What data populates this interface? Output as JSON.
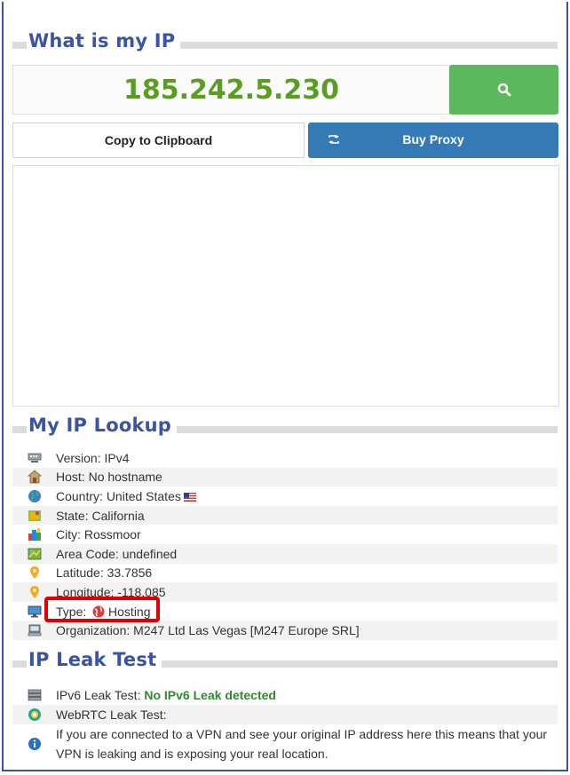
{
  "colors": {
    "brand": "#3a53a4",
    "ip_green": "#5a9e1f",
    "search_button": "#5cb85c",
    "buy_button": "#337ab7",
    "highlight": "#e00000",
    "leak_ok": "#2e8b2e"
  },
  "header": {
    "title": "What is my IP"
  },
  "ip": {
    "address": "185.242.5.230"
  },
  "actions": {
    "search_icon": "search-icon",
    "copy_label": "Copy to Clipboard",
    "buy_label": "Buy Proxy",
    "buy_icon": "retweet-icon"
  },
  "lookup": {
    "title": "My IP Lookup",
    "rows": [
      {
        "label": "Version:",
        "value": "IPv4",
        "icon": "network-card-icon"
      },
      {
        "label": "Host:",
        "value": "No hostname",
        "icon": "house-icon"
      },
      {
        "label": "Country:",
        "value": "United States",
        "icon": "globe-icon",
        "flag": "us-flag-icon"
      },
      {
        "label": "State:",
        "value": "California",
        "icon": "state-map-icon"
      },
      {
        "label": "City:",
        "value": "Rossmoor",
        "icon": "city-buildings-icon"
      },
      {
        "label": "Area Code:",
        "value": "undefined",
        "icon": "map-icon"
      },
      {
        "label": "Latitude:",
        "value": "33.7856",
        "icon": "map-pin-icon"
      },
      {
        "label": "Longitude:",
        "value": "-118.085",
        "icon": "map-pin-icon"
      },
      {
        "label": "Type:",
        "value": "Hosting",
        "icon": "monitor-icon",
        "type_icon": "globe-red-icon"
      },
      {
        "label": "Organization:",
        "value": "M247 Ltd Las Vegas [M247 Europe SRL]",
        "icon": "computer-icon"
      }
    ]
  },
  "leak": {
    "title": "IP Leak Test",
    "ipv6_label": "IPv6 Leak Test:",
    "ipv6_result": "No IPv6 Leak detected",
    "webrtc_label": "WebRTC Leak Test:",
    "info_text": "If you are connected to a VPN and see your original IP address here this means that your VPN is leaking and is exposing your real location."
  }
}
